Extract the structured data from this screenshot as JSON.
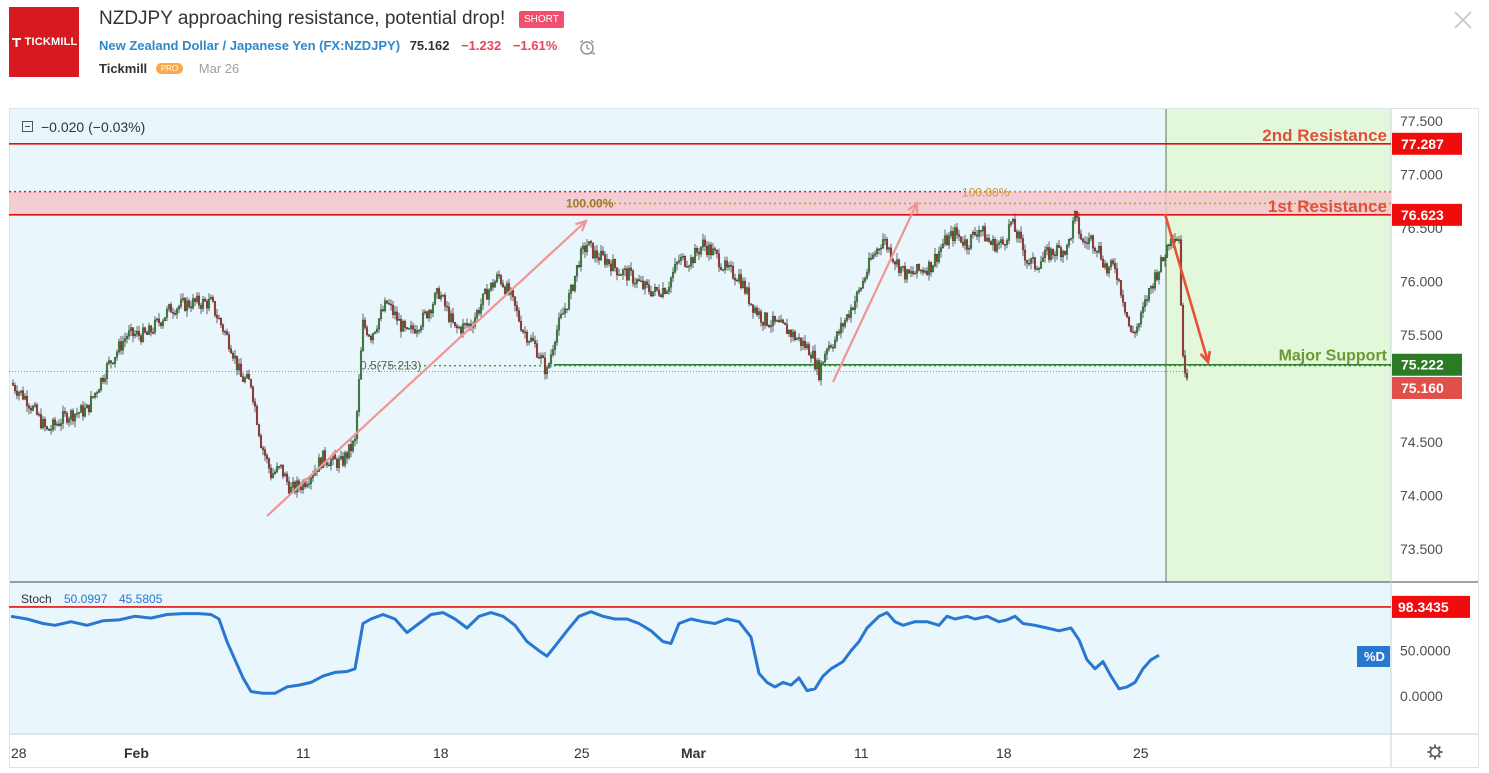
{
  "header": {
    "logo_text": "TICKMILL",
    "title": "NZDJPY approaching resistance, potential drop!",
    "badge": "SHORT",
    "symbol_name": "New Zealand Dollar / Japanese Yen",
    "symbol_code_open": " (",
    "symbol_code": "FX:NZDJPY",
    "symbol_code_close": ")",
    "price": "75.162",
    "change": "−1.232",
    "change_pct": "−1.61%",
    "author": "Tickmill",
    "author_badge": "PRO",
    "date": "Mar 26"
  },
  "chart_header": {
    "change_text": "−0.020 (−0.03%)"
  },
  "colors": {
    "bg": "#e9f6fc",
    "forecast_bg": "#e3f7da",
    "up": "#3a8f3a",
    "down": "#b0352f",
    "resistance": "#ff0000",
    "support": "#2f7a2f",
    "arrow_pink": "#f09494",
    "arrow_red": "#e8503a",
    "stoch": "#2877d0",
    "fib": "#c8a030"
  },
  "chart_data": {
    "type": "candlestick",
    "symbol": "NZDJPY",
    "ylim": [
      73.2,
      77.7
    ],
    "y_ticks": [
      "77.500",
      "77.000",
      "76.500",
      "76.000",
      "75.500",
      "75.000",
      "74.500",
      "74.000",
      "73.500"
    ],
    "x_ticks": [
      {
        "label": "28",
        "bold": false
      },
      {
        "label": "Feb",
        "bold": true
      },
      {
        "label": "11",
        "bold": false
      },
      {
        "label": "18",
        "bold": false
      },
      {
        "label": "25",
        "bold": false
      },
      {
        "label": "Mar",
        "bold": true
      },
      {
        "label": "11",
        "bold": false
      },
      {
        "label": "18",
        "bold": false
      },
      {
        "label": "25",
        "bold": false
      }
    ],
    "price_path": [
      [
        0,
        75.05
      ],
      [
        8,
        74.9
      ],
      [
        18,
        74.6
      ],
      [
        28,
        74.75
      ],
      [
        38,
        74.8
      ],
      [
        48,
        75.2
      ],
      [
        58,
        75.5
      ],
      [
        68,
        75.5
      ],
      [
        80,
        75.75
      ],
      [
        90,
        75.8
      ],
      [
        100,
        75.8
      ],
      [
        105,
        75.6
      ],
      [
        110,
        75.4
      ],
      [
        115,
        75.1
      ],
      [
        120,
        75.05
      ],
      [
        125,
        74.5
      ],
      [
        130,
        74.2
      ],
      [
        135,
        74.25
      ],
      [
        140,
        74.05
      ],
      [
        145,
        74.1
      ],
      [
        150,
        74.2
      ],
      [
        156,
        74.35
      ],
      [
        165,
        74.3
      ],
      [
        172,
        74.5
      ],
      [
        176,
        75.6
      ],
      [
        180,
        75.5
      ],
      [
        188,
        75.8
      ],
      [
        198,
        75.5
      ],
      [
        206,
        75.65
      ],
      [
        214,
        75.9
      ],
      [
        222,
        75.55
      ],
      [
        230,
        75.6
      ],
      [
        238,
        75.9
      ],
      [
        244,
        76.05
      ],
      [
        250,
        75.85
      ],
      [
        256,
        75.55
      ],
      [
        262,
        75.4
      ],
      [
        268,
        75.15
      ],
      [
        272,
        75.5
      ],
      [
        276,
        75.7
      ],
      [
        280,
        75.9
      ],
      [
        284,
        76.2
      ],
      [
        288,
        76.35
      ],
      [
        292,
        76.25
      ],
      [
        298,
        76.2
      ],
      [
        304,
        76.1
      ],
      [
        310,
        76.05
      ],
      [
        316,
        75.95
      ],
      [
        322,
        75.9
      ],
      [
        328,
        75.95
      ],
      [
        334,
        76.2
      ],
      [
        340,
        76.2
      ],
      [
        346,
        76.35
      ],
      [
        352,
        76.25
      ],
      [
        358,
        76.1
      ],
      [
        364,
        76.05
      ],
      [
        370,
        75.8
      ],
      [
        376,
        75.65
      ],
      [
        382,
        75.6
      ],
      [
        388,
        75.55
      ],
      [
        394,
        75.45
      ],
      [
        400,
        75.35
      ],
      [
        404,
        75.15
      ],
      [
        408,
        75.4
      ],
      [
        412,
        75.45
      ],
      [
        416,
        75.6
      ],
      [
        420,
        75.75
      ],
      [
        424,
        75.9
      ],
      [
        430,
        76.2
      ],
      [
        436,
        76.4
      ],
      [
        442,
        76.2
      ],
      [
        448,
        76.05
      ],
      [
        454,
        76.1
      ],
      [
        460,
        76.15
      ],
      [
        466,
        76.35
      ],
      [
        472,
        76.45
      ],
      [
        478,
        76.35
      ],
      [
        484,
        76.5
      ],
      [
        490,
        76.35
      ],
      [
        496,
        76.35
      ],
      [
        500,
        76.55
      ],
      [
        504,
        76.4
      ],
      [
        508,
        76.2
      ],
      [
        512,
        76.15
      ],
      [
        518,
        76.25
      ],
      [
        524,
        76.3
      ],
      [
        528,
        76.3
      ],
      [
        532,
        76.6
      ],
      [
        536,
        76.35
      ],
      [
        540,
        76.4
      ],
      [
        544,
        76.3
      ],
      [
        548,
        76.1
      ],
      [
        552,
        76.15
      ],
      [
        556,
        75.85
      ],
      [
        560,
        75.5
      ],
      [
        564,
        75.6
      ],
      [
        568,
        75.85
      ],
      [
        572,
        76.05
      ],
      [
        576,
        76.2
      ],
      [
        580,
        76.45
      ],
      [
        584,
        76.4
      ],
      [
        586,
        75.25
      ],
      [
        588,
        75.16
      ]
    ],
    "stoch_path": [
      [
        0,
        88
      ],
      [
        8,
        85
      ],
      [
        16,
        80
      ],
      [
        22,
        78
      ],
      [
        30,
        82
      ],
      [
        38,
        78
      ],
      [
        46,
        83
      ],
      [
        54,
        84
      ],
      [
        62,
        88
      ],
      [
        70,
        86
      ],
      [
        78,
        90
      ],
      [
        86,
        91
      ],
      [
        94,
        91
      ],
      [
        100,
        90
      ],
      [
        104,
        85
      ],
      [
        108,
        60
      ],
      [
        112,
        40
      ],
      [
        116,
        20
      ],
      [
        120,
        5
      ],
      [
        126,
        3
      ],
      [
        132,
        3
      ],
      [
        138,
        10
      ],
      [
        144,
        12
      ],
      [
        150,
        15
      ],
      [
        156,
        22
      ],
      [
        162,
        26
      ],
      [
        168,
        27
      ],
      [
        172,
        30
      ],
      [
        176,
        80
      ],
      [
        180,
        85
      ],
      [
        186,
        90
      ],
      [
        192,
        85
      ],
      [
        198,
        70
      ],
      [
        204,
        80
      ],
      [
        210,
        90
      ],
      [
        216,
        92
      ],
      [
        222,
        85
      ],
      [
        228,
        75
      ],
      [
        234,
        88
      ],
      [
        240,
        92
      ],
      [
        246,
        88
      ],
      [
        252,
        78
      ],
      [
        258,
        60
      ],
      [
        264,
        50
      ],
      [
        268,
        44
      ],
      [
        272,
        55
      ],
      [
        278,
        72
      ],
      [
        284,
        88
      ],
      [
        290,
        93
      ],
      [
        296,
        88
      ],
      [
        302,
        85
      ],
      [
        308,
        85
      ],
      [
        314,
        80
      ],
      [
        320,
        72
      ],
      [
        326,
        60
      ],
      [
        330,
        58
      ],
      [
        334,
        80
      ],
      [
        340,
        85
      ],
      [
        346,
        82
      ],
      [
        352,
        80
      ],
      [
        358,
        85
      ],
      [
        364,
        82
      ],
      [
        370,
        65
      ],
      [
        374,
        25
      ],
      [
        378,
        15
      ],
      [
        382,
        10
      ],
      [
        386,
        15
      ],
      [
        390,
        12
      ],
      [
        394,
        20
      ],
      [
        398,
        6
      ],
      [
        402,
        8
      ],
      [
        406,
        22
      ],
      [
        410,
        30
      ],
      [
        416,
        38
      ],
      [
        420,
        50
      ],
      [
        424,
        60
      ],
      [
        428,
        75
      ],
      [
        434,
        88
      ],
      [
        438,
        92
      ],
      [
        442,
        82
      ],
      [
        446,
        78
      ],
      [
        452,
        82
      ],
      [
        458,
        82
      ],
      [
        464,
        78
      ],
      [
        468,
        88
      ],
      [
        472,
        85
      ],
      [
        478,
        88
      ],
      [
        482,
        85
      ],
      [
        488,
        88
      ],
      [
        494,
        82
      ],
      [
        498,
        84
      ],
      [
        502,
        88
      ],
      [
        506,
        80
      ],
      [
        512,
        78
      ],
      [
        518,
        75
      ],
      [
        524,
        72
      ],
      [
        530,
        75
      ],
      [
        534,
        62
      ],
      [
        538,
        40
      ],
      [
        542,
        30
      ],
      [
        546,
        38
      ],
      [
        550,
        22
      ],
      [
        554,
        8
      ],
      [
        558,
        10
      ],
      [
        562,
        15
      ],
      [
        566,
        30
      ],
      [
        570,
        40
      ],
      [
        574,
        45
      ]
    ],
    "levels": [
      {
        "name": "2nd Resistance",
        "value": 77.287,
        "label": "77.287"
      },
      {
        "name": "1st Resistance",
        "value": 76.623,
        "label": "76.623"
      },
      {
        "name": "Major Support",
        "value": 75.222,
        "label": "75.222"
      }
    ],
    "last_price": {
      "value": 75.16,
      "label": "75.160"
    },
    "resistance_zone": [
      76.62,
      76.84
    ],
    "fib_labels": {
      "f100_a": "100.00%",
      "f100_b": "100.00%",
      "f05": "0.5(75.213)"
    },
    "stoch": {
      "label": "Stoch",
      "k": "50.0997",
      "d": "45.5805",
      "level_label": "98.3435",
      "d_badge": "%D",
      "y_ticks": [
        "50.0000",
        "0.0000"
      ],
      "ylim": [
        -20,
        115
      ]
    }
  }
}
